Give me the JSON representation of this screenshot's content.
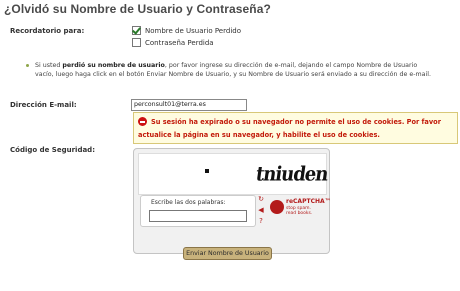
{
  "page": {
    "title": "¿Olvidó su Nombre de Usuario y Contraseña?"
  },
  "reminder": {
    "label": "Recordatorio para:",
    "options": [
      {
        "label": "Nombre de Usuario Perdido",
        "checked": true
      },
      {
        "label": "Contraseña Perdida",
        "checked": false
      }
    ]
  },
  "info": {
    "part1": "Si usted ",
    "bold": "perdió su nombre de usuario",
    "part2": ", por favor ingrese su dirección de e-mail, dejando el campo Nombre de Usuario vacío, luego haga click en el botón Enviar Nombre de Usuario, y su Nombre de Usuario será enviado a su dirección de e-mail."
  },
  "email": {
    "label": "Dirección E-mail:",
    "value": "perconsult01@terra.es"
  },
  "error": {
    "line1": "Su sesión ha expirado o su navegador no permite el uso de cookies. Por favor",
    "line2": "actualice la página en su navegador, y habilite el uso de cookies."
  },
  "security": {
    "label": "Código de Seguridad:",
    "captcha_words": "tniuden",
    "answer_label": "Escribe las dos palabras:",
    "answer_value": "",
    "brand": "reCAPTCHA™",
    "tagline1": "stop spam.",
    "tagline2": "read books."
  },
  "submit": {
    "label": "Enviar Nombre de Usuario"
  },
  "colors": {
    "error_text": "#c21a0a",
    "error_bg": "#fffce0",
    "button_bg": "#c8b27c",
    "recaptcha_red": "#b31b1b"
  }
}
